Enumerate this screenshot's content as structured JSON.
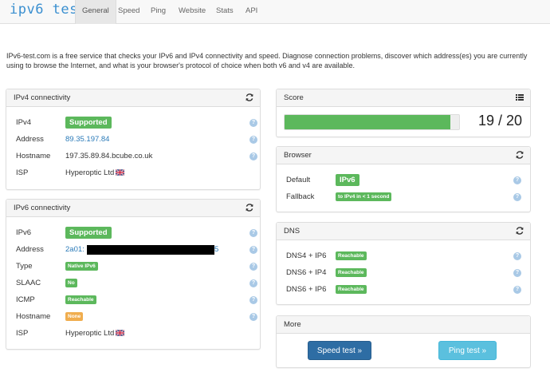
{
  "nav": {
    "brand": "ipv6 test",
    "tabs": [
      {
        "label": "General",
        "active": true
      },
      {
        "label": "Speed",
        "active": false
      },
      {
        "label": "Ping",
        "active": false
      },
      {
        "label": "Website",
        "active": false
      },
      {
        "label": "Stats",
        "active": false
      },
      {
        "label": "API",
        "active": false
      }
    ]
  },
  "intro": "IPv6-test.com is a free service that checks your IPv6 and IPv4 connectivity and speed. Diagnose connection problems, discover which address(es) you are currently using to browse the Internet, and what is your browser's protocol of choice when both v6 and v4 are available.",
  "ipv4": {
    "title": "IPv4 connectivity",
    "rows": [
      {
        "label": "IPv4",
        "value": "Supported"
      },
      {
        "label": "Address",
        "value": "89.35.197.84"
      },
      {
        "label": "Hostname",
        "value": "197.35.89.84.bcube.co.uk"
      },
      {
        "label": "ISP",
        "value": "Hyperoptic Ltd"
      }
    ]
  },
  "ipv6": {
    "title": "IPv6 connectivity",
    "rows": [
      {
        "label": "IPv6",
        "value": "Supported"
      },
      {
        "label": "Address",
        "value": "2a01:",
        "suffix": "5"
      },
      {
        "label": "Type",
        "value": "Native IPv6"
      },
      {
        "label": "SLAAC",
        "value": "No"
      },
      {
        "label": "ICMP",
        "value": "Reachable"
      },
      {
        "label": "Hostname",
        "value": "None"
      },
      {
        "label": "ISP",
        "value": "Hyperoptic Ltd"
      }
    ]
  },
  "score": {
    "title": "Score",
    "text": "19 / 20",
    "fraction": 0.95
  },
  "browser": {
    "title": "Browser",
    "rows": [
      {
        "label": "Default",
        "value": "IPv6"
      },
      {
        "label": "Fallback",
        "value": "to IPv4 in < 1 second"
      }
    ]
  },
  "dns": {
    "title": "DNS",
    "rows": [
      {
        "label": "DNS4 + IP6",
        "value": "Reachable"
      },
      {
        "label": "DNS6 + IP4",
        "value": "Reachable"
      },
      {
        "label": "DNS6 + IP6",
        "value": "Reachable"
      }
    ]
  },
  "more": {
    "title": "More",
    "speed_button": "Speed test »",
    "ping_button": "Ping test »"
  },
  "help_glyph": "?",
  "icons": {
    "refresh": "refresh-icon",
    "list": "list-icon",
    "help": "help-icon",
    "flag": "uk-flag-icon"
  },
  "colors": {
    "brand": "#3a8fd0",
    "success": "#5cb85c",
    "warning": "#f0ad4e",
    "primary": "#2e6da4",
    "info": "#5bc0de",
    "link": "#2a7ab8"
  }
}
